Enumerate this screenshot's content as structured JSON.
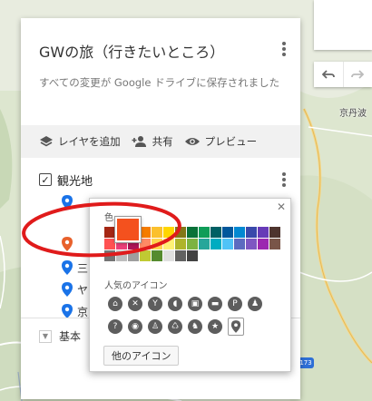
{
  "map": {
    "place_label": "京丹波",
    "route_number": "173"
  },
  "nav": {
    "undo_icon": "undo-icon",
    "redo_icon": "redo-icon"
  },
  "panel": {
    "title": "GWの旅（行きたいところ）",
    "subtitle": "すべての変更が Google ドライブに保存されました",
    "toolbar": {
      "add_layer": "レイヤを追加",
      "share": "共有",
      "preview": "プレビュー"
    },
    "layer": {
      "name": "観光地",
      "checked": true
    },
    "places": [
      {
        "label": "",
        "color": "#e8612c"
      },
      {
        "label": "三",
        "color": "#1a73e8"
      },
      {
        "label": "ヤ",
        "color": "#1a73e8"
      },
      {
        "label": "京",
        "color": "#1a73e8"
      }
    ],
    "base_map": "基本"
  },
  "picker": {
    "color_heading": "色",
    "selected_color": "#f4511e",
    "colors": [
      "#a52714",
      "#e91e63",
      "#c2185b",
      "#f57c00",
      "#fbc02d",
      "#ffd600",
      "#827717",
      "#097138",
      "#0f9d58",
      "#006064",
      "#01579b",
      "#0288d1",
      "#3949ab",
      "#673ab7",
      "#4e342e",
      "#ff5252",
      "#ec407a",
      "#ad1457",
      "#ff8a65",
      "#ffd54f",
      "#fff176",
      "#afb42b",
      "#7cb342",
      "#26a69a",
      "#00acc1",
      "#4fc3f7",
      "#5c6bc0",
      "#7e57c2",
      "#9c27b0",
      "#795548",
      "#757575",
      "#bdbdbd",
      "#9e9e9e",
      "#c0ca33",
      "#558b2f",
      "#e0e0e0",
      "#616161",
      "#424242"
    ],
    "popular_icons_heading": "人気のアイコン",
    "icons": [
      "home-icon",
      "dining-icon",
      "bar-icon",
      "cafe-icon",
      "shopping-icon",
      "hotel-icon",
      "parking-icon",
      "hiking-icon",
      "question-icon",
      "camera-icon",
      "walking-icon",
      "bicycle-icon",
      "running-icon",
      "star-icon",
      "pin-icon"
    ],
    "icon_glyphs": [
      "⌂",
      "✕",
      "Y",
      "◖",
      "▣",
      "▬",
      "P",
      "♟",
      "?",
      "◉",
      "♙",
      "♺",
      "♞",
      "★",
      ""
    ],
    "more_icons_button": "他のアイコン",
    "close_icon": "close-icon"
  }
}
